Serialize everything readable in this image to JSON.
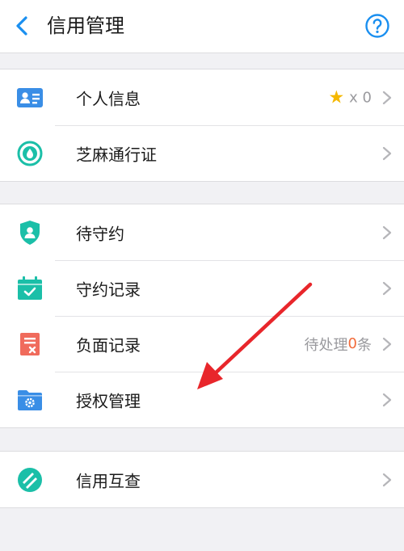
{
  "header": {
    "title": "信用管理",
    "back_icon": "chevron-left-icon",
    "help_icon": "question-circle-icon",
    "accent": "#1a8ff0"
  },
  "groups": [
    {
      "items": [
        {
          "label": "个人信息",
          "icon": "id-card-icon",
          "right_star": "★",
          "right_text": "x 0"
        },
        {
          "label": "芝麻通行证",
          "icon": "sesame-pass-icon"
        }
      ]
    },
    {
      "items": [
        {
          "label": "待守约",
          "icon": "shield-user-icon"
        },
        {
          "label": "守约记录",
          "icon": "calendar-check-icon"
        },
        {
          "label": "负面记录",
          "icon": "negative-record-icon",
          "right_prefix": "待处理",
          "right_count": "0",
          "right_suffix": "条"
        },
        {
          "label": "授权管理",
          "icon": "folder-gear-icon"
        }
      ]
    },
    {
      "items": [
        {
          "label": "信用互查",
          "icon": "credit-mutual-check-icon"
        }
      ]
    }
  ],
  "annotation": {
    "color": "#e8262b",
    "type": "red-arrow-pointing-to-授权管理"
  }
}
